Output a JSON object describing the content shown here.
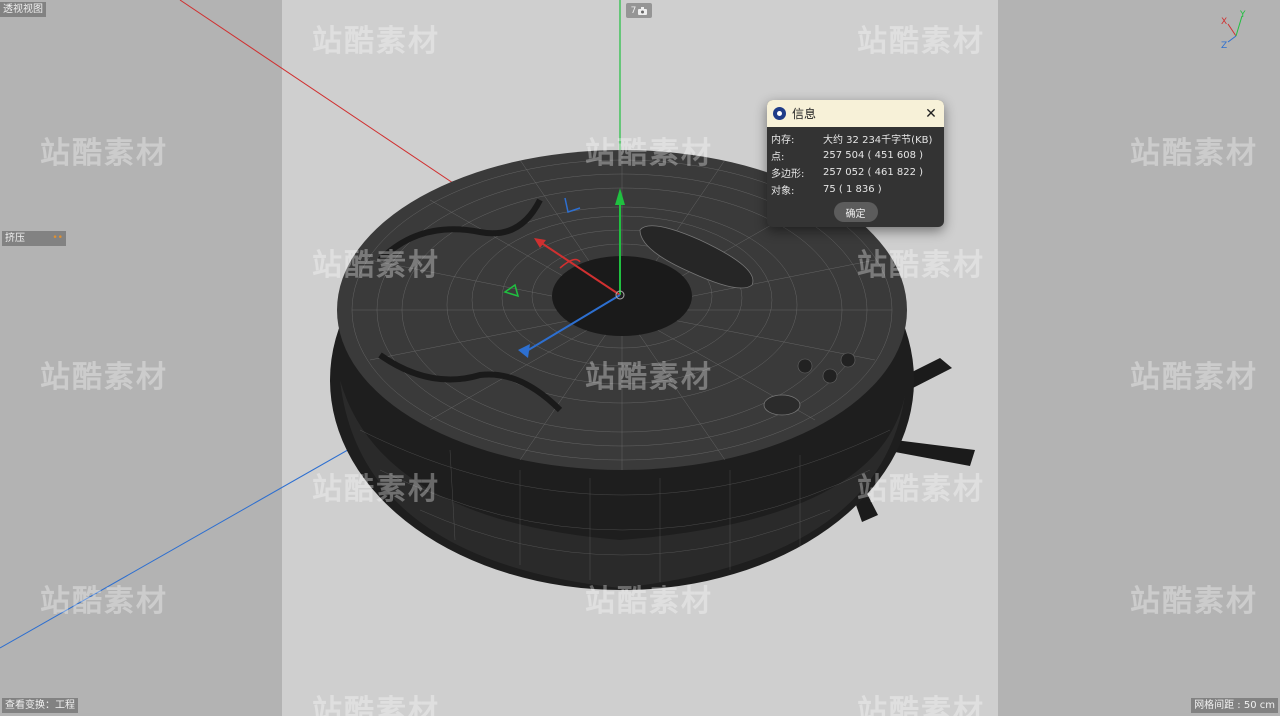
{
  "viewport": {
    "title": "透视视图",
    "tool_name": "挤压",
    "tool_dots": "••",
    "camera_label": "7",
    "status_left": "查看变换：工程",
    "status_right": "网格间距 : 50 cm"
  },
  "axis_gizmo": {
    "x": "X",
    "y": "Y",
    "z": "Z"
  },
  "watermark_text": "站酷素材",
  "dialog": {
    "title": "信息",
    "rows": [
      {
        "key": "内存:",
        "value": "大约 32 234千字节(KB)"
      },
      {
        "key": "点:",
        "value": "257 504 ( 451 608 )"
      },
      {
        "key": "多边形:",
        "value": "257 052 ( 461 822 )"
      },
      {
        "key": "对象:",
        "value": "75 ( 1 836 )"
      }
    ],
    "ok_label": "确定"
  },
  "colors": {
    "axis_x": "#d03030",
    "axis_y": "#20c040",
    "axis_z": "#2d6fd0",
    "mesh": "#222222",
    "viewport_bg": "#b3b3b3",
    "safe_frame_bg": "#cfcfcf"
  },
  "icons": {
    "app": "cinema4d-logo-icon",
    "close": "close-icon",
    "camera": "camera-icon"
  }
}
